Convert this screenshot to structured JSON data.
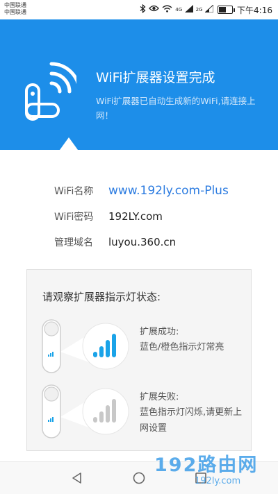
{
  "status_bar": {
    "carrier_1": "中国联通",
    "carrier_2": "中国联通",
    "time": "下午4:16",
    "signal_1_tag": "4G",
    "signal_2_tag": "2G",
    "battery_level_percent": 60,
    "icons": [
      "bluetooth-icon",
      "eye-icon",
      "wifi-icon",
      "signal-icon",
      "signal-icon",
      "battery-icon"
    ]
  },
  "header": {
    "title": "WiFi扩展器设置完成",
    "subtitle": "WiFi扩展器已自动生成新的WiFi,请连接上网！",
    "background": "#1d8ee9"
  },
  "info": {
    "ssid_label": "WiFi名称",
    "ssid_value": "www.192ly.com-Plus",
    "password_label": "WiFi密码",
    "password_value": "192LY.com",
    "domain_label": "管理域名",
    "domain_value": "luyou.360.cn"
  },
  "indicator_card": {
    "title": "请观察扩展器指示灯状态:",
    "success_title": "扩展成功:",
    "success_desc": "蓝色/橙色指示灯常亮",
    "fail_title": "扩展失败:",
    "fail_desc": "蓝色指示灯闪烁,请更新上网设置",
    "accent": "#1aa3e8"
  },
  "watermark": {
    "main": "192路由网",
    "sub": "192ly.com"
  }
}
